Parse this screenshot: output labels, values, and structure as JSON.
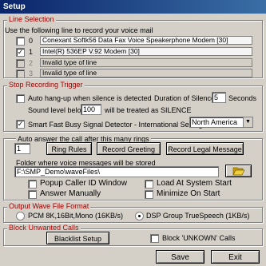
{
  "window": {
    "title": "Setup"
  },
  "line_selection": {
    "legend": "Line Selection",
    "instruction": "Use the following line to record your voice mail",
    "lines": [
      {
        "num": "0",
        "checked": false,
        "enabled": true,
        "label": "Conexant Softk56 Data Fax Voice Speakerphone Modem  [30]"
      },
      {
        "num": "1",
        "checked": true,
        "enabled": true,
        "label": "Intel(R) 536EP V.92 Modem  [30]"
      },
      {
        "num": "2",
        "checked": false,
        "enabled": false,
        "label": "Invalid type of line"
      },
      {
        "num": "3",
        "checked": false,
        "enabled": false,
        "label": "Invalid type of line"
      }
    ]
  },
  "stop_trigger": {
    "legend": "Stop Recording Trigger",
    "auto_hangup_label": "Auto hang-up when silence is detected",
    "auto_hangup_checked": false,
    "duration_label": "Duration of Silence",
    "duration_value": "5",
    "seconds_label": "Seconds",
    "sound_level_label": "Sound level below",
    "sound_level_value": "100",
    "silence_label": "will be treated as SILENCE",
    "busy_detector_label": "Smart Fast Busy Signal Detector  -  International Setting:",
    "busy_detector_checked": true,
    "international_value": "North America"
  },
  "answer": {
    "rings_label": "Auto answer the call after this many rings",
    "rings_value": "1",
    "ring_rules_button": "Ring Rules",
    "record_greeting_button": "Record Greeting",
    "record_legal_button": "Record Legal Message",
    "folder_label": "Folder where voice messages will be stored",
    "folder_value": "F:\\SMP_Demo\\waveFiles\\",
    "popup_caller_label": "Popup Caller ID Window",
    "answer_manually_label": "Answer Manually",
    "load_startup_label": "Load At System Start",
    "minimize_label": "Minimize On Start"
  },
  "wave_format": {
    "legend": "Output Wave File Format",
    "pcm_label": "PCM 8K,16Bit,Mono  (16KB/s)",
    "dsp_label": "DSP Group TrueSpeech  (1KB/s)",
    "selected": "dsp"
  },
  "block": {
    "legend": "Block Unwanted Calls",
    "blacklist_button": "Blacklist Setup",
    "block_unknown_label": "Block 'UNKOWN' Calls"
  },
  "footer": {
    "save_button": "Save",
    "exit_button": "Exit"
  },
  "colors": {
    "titlebar": "#0a246a",
    "legend_text": "#a00000",
    "dialog_bg": "#d4d0c8"
  }
}
